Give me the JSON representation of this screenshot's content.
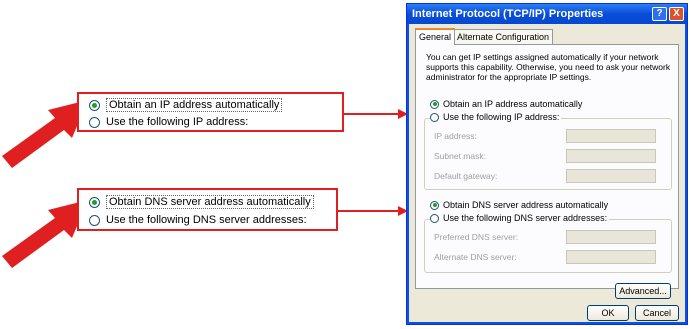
{
  "callouts": {
    "ip": {
      "auto_label": "Obtain an IP address automatically",
      "manual_label": "Use the following IP address:"
    },
    "dns": {
      "auto_label": "Obtain DNS server address automatically",
      "manual_label": "Use the following DNS server addresses:"
    }
  },
  "dialog": {
    "title": "Internet Protocol (TCP/IP) Properties",
    "help_btn": "?",
    "close_btn": "X",
    "tabs": [
      "General",
      "Alternate Configuration"
    ],
    "description": "You can get IP settings assigned automatically if your network supports this capability. Otherwise, you need to ask your network administrator for the appropriate IP settings.",
    "ip_auto": "Obtain an IP address automatically",
    "ip_manual": "Use the following IP address:",
    "ip_fields": [
      "IP address:",
      "Subnet mask:",
      "Default gateway:"
    ],
    "dns_auto": "Obtain DNS server address automatically",
    "dns_manual": "Use the following DNS server addresses:",
    "dns_fields": [
      "Preferred DNS server:",
      "Alternate DNS server:"
    ],
    "advanced_btn": "Advanced...",
    "ok_btn": "OK",
    "cancel_btn": "Cancel"
  },
  "colors": {
    "callout_red": "#e02020",
    "radio_green": "#1e9e1e",
    "title_blue": "#0a4ed8"
  }
}
